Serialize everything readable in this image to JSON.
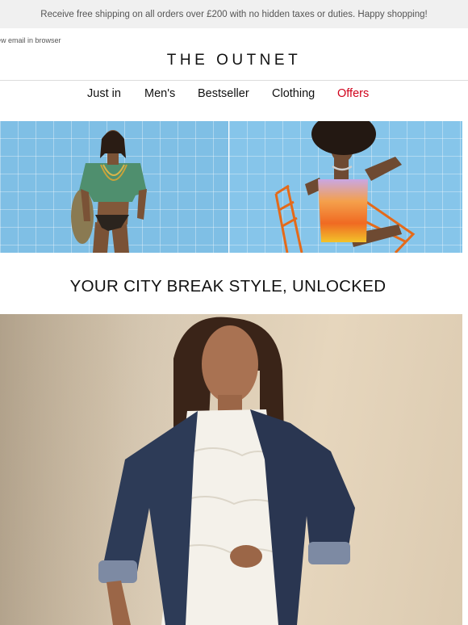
{
  "promo": {
    "text": "Receive free shipping on all orders over £200 with no hidden taxes or duties. Happy shopping!"
  },
  "header": {
    "browser_link": "ew email in browser",
    "logo": "THE OUTNET"
  },
  "nav": {
    "items": [
      {
        "label": "Just in"
      },
      {
        "label": "Men's"
      },
      {
        "label": "Bestseller"
      },
      {
        "label": "Clothing"
      },
      {
        "label": "Offers",
        "color": "#d0021b"
      }
    ]
  },
  "headline": {
    "text": "YOUR CITY BREAK STYLE, UNLOCKED"
  },
  "colors": {
    "promo_bg": "#f0f0f0",
    "offers": "#d0021b",
    "tile_blue": "#7fbfe5"
  }
}
